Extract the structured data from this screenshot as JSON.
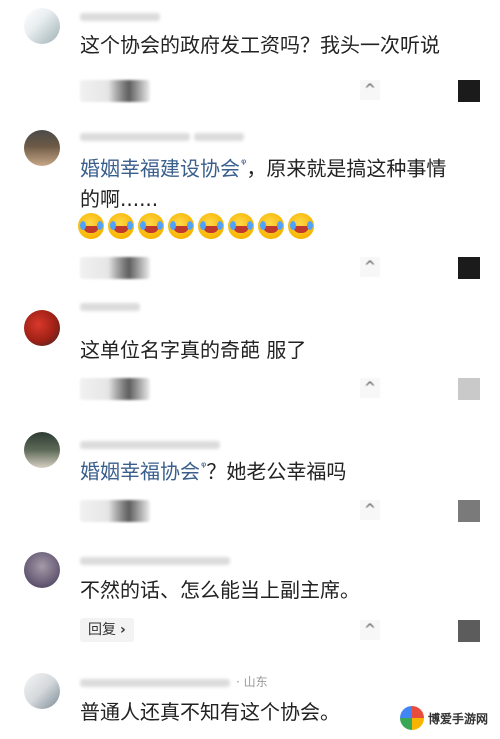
{
  "comments": [
    {
      "text": "这个协会的政府发工资吗？我头一次听说"
    },
    {
      "mention": "婚姻幸福建设协会",
      "text_after": "，原来就是搞这种事情",
      "text_line2": "的啊......"
    },
    {
      "text": "这单位名字真的奇葩 服了"
    },
    {
      "mention": "婚姻幸福协会",
      "text_after": "？她老公幸福吗"
    },
    {
      "text": "不然的话、怎么能当上副主席。",
      "reply_label": "回复"
    },
    {
      "location": "· 山东",
      "text": "普通人还真不知有这个协会。"
    }
  ],
  "icons": {
    "mention_icon": "magnifier-icon",
    "emoji": "crying-laughing-emoji-icon",
    "reply_chevron": "chevron-right-icon"
  },
  "watermark": {
    "text": "博爱手游网"
  },
  "colors": {
    "mention": "#3a5f8c",
    "text": "#222222",
    "meta": "#bdbdbd"
  }
}
